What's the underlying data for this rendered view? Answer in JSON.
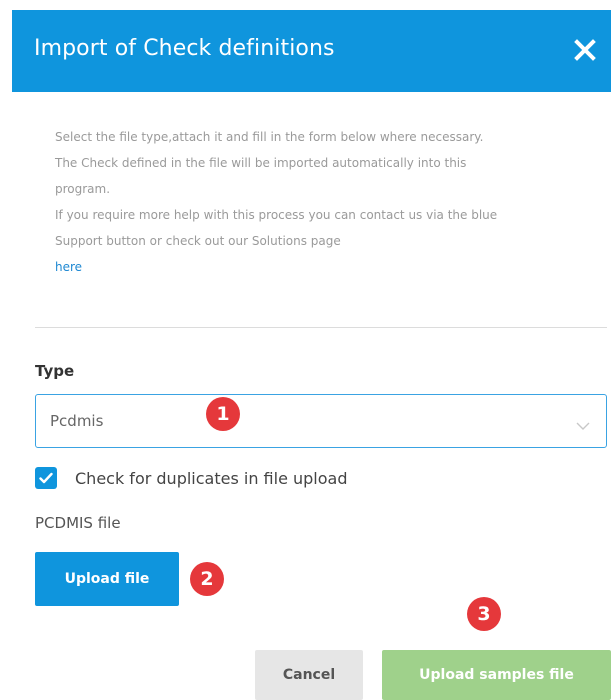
{
  "dialog": {
    "title": "Import of Check definitions",
    "close_icon": "close-icon"
  },
  "intro": {
    "line1": "Select the file type,attach it and fill in the form below where necessary.",
    "line2": "The Check defined in the file will be imported automatically into this",
    "line3": "program.",
    "line4": "If you require more help with this process you can contact us via the blue",
    "line5": "Support button or check out our Solutions page",
    "link_text": "here"
  },
  "form": {
    "type_label": "Type",
    "type_value": "Pcdmis",
    "duplicates_label": "Check for duplicates in file upload",
    "duplicates_checked": true,
    "file_label": "PCDMIS file",
    "upload_file_label": "Upload file"
  },
  "footer": {
    "cancel_label": "Cancel",
    "upload_samples_label": "Upload samples file"
  },
  "annotations": {
    "badge1": "1",
    "badge2": "2",
    "badge3": "3"
  },
  "colors": {
    "header_bg": "#0f95dd",
    "primary_button": "#0f95dd",
    "success_button_disabled": "#9fd18b",
    "cancel_button": "#e6e6e6",
    "badge": "#e5383b",
    "link": "#1e88d2"
  }
}
